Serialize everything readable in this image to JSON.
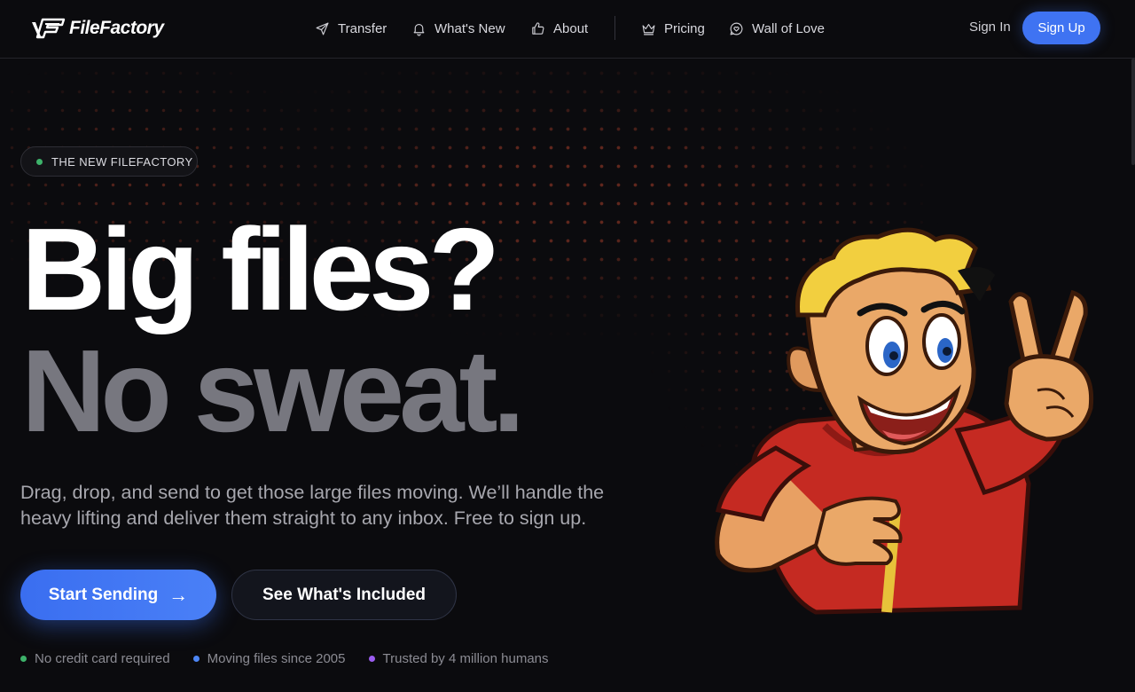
{
  "brand": {
    "name": "FileFactory"
  },
  "nav": {
    "items": [
      {
        "label": "Transfer",
        "icon": "send-icon"
      },
      {
        "label": "What's New",
        "icon": "bell-icon"
      },
      {
        "label": "About",
        "icon": "thumbs-up-icon"
      },
      {
        "label": "Pricing",
        "icon": "crown-icon"
      },
      {
        "label": "Wall of Love",
        "icon": "heart-chat-icon"
      }
    ],
    "sign_in": "Sign In",
    "sign_up": "Sign Up"
  },
  "hero": {
    "badge": "THE NEW FILEFACTORY",
    "headline_1": "Big files?",
    "headline_2": "No sweat.",
    "subtitle": "Drag, drop, and send to get those large files moving. We’ll handle the heavy lifting and deliver them straight to any inbox. Free to sign up.",
    "primary_cta": "Start Sending",
    "primary_cta_arrow": "→",
    "secondary_cta": "See What's Included",
    "features": [
      {
        "label": "No credit card required",
        "color": "#3db26a"
      },
      {
        "label": "Moving files since 2005",
        "color": "#4d86f5"
      },
      {
        "label": "Trusted by 4 million humans",
        "color": "#9b5cf0"
      }
    ]
  },
  "colors": {
    "background": "#0b0b0e",
    "accent": "#3f73f2",
    "headline_secondary": "#77777f",
    "dot_pattern": "#c44830"
  }
}
